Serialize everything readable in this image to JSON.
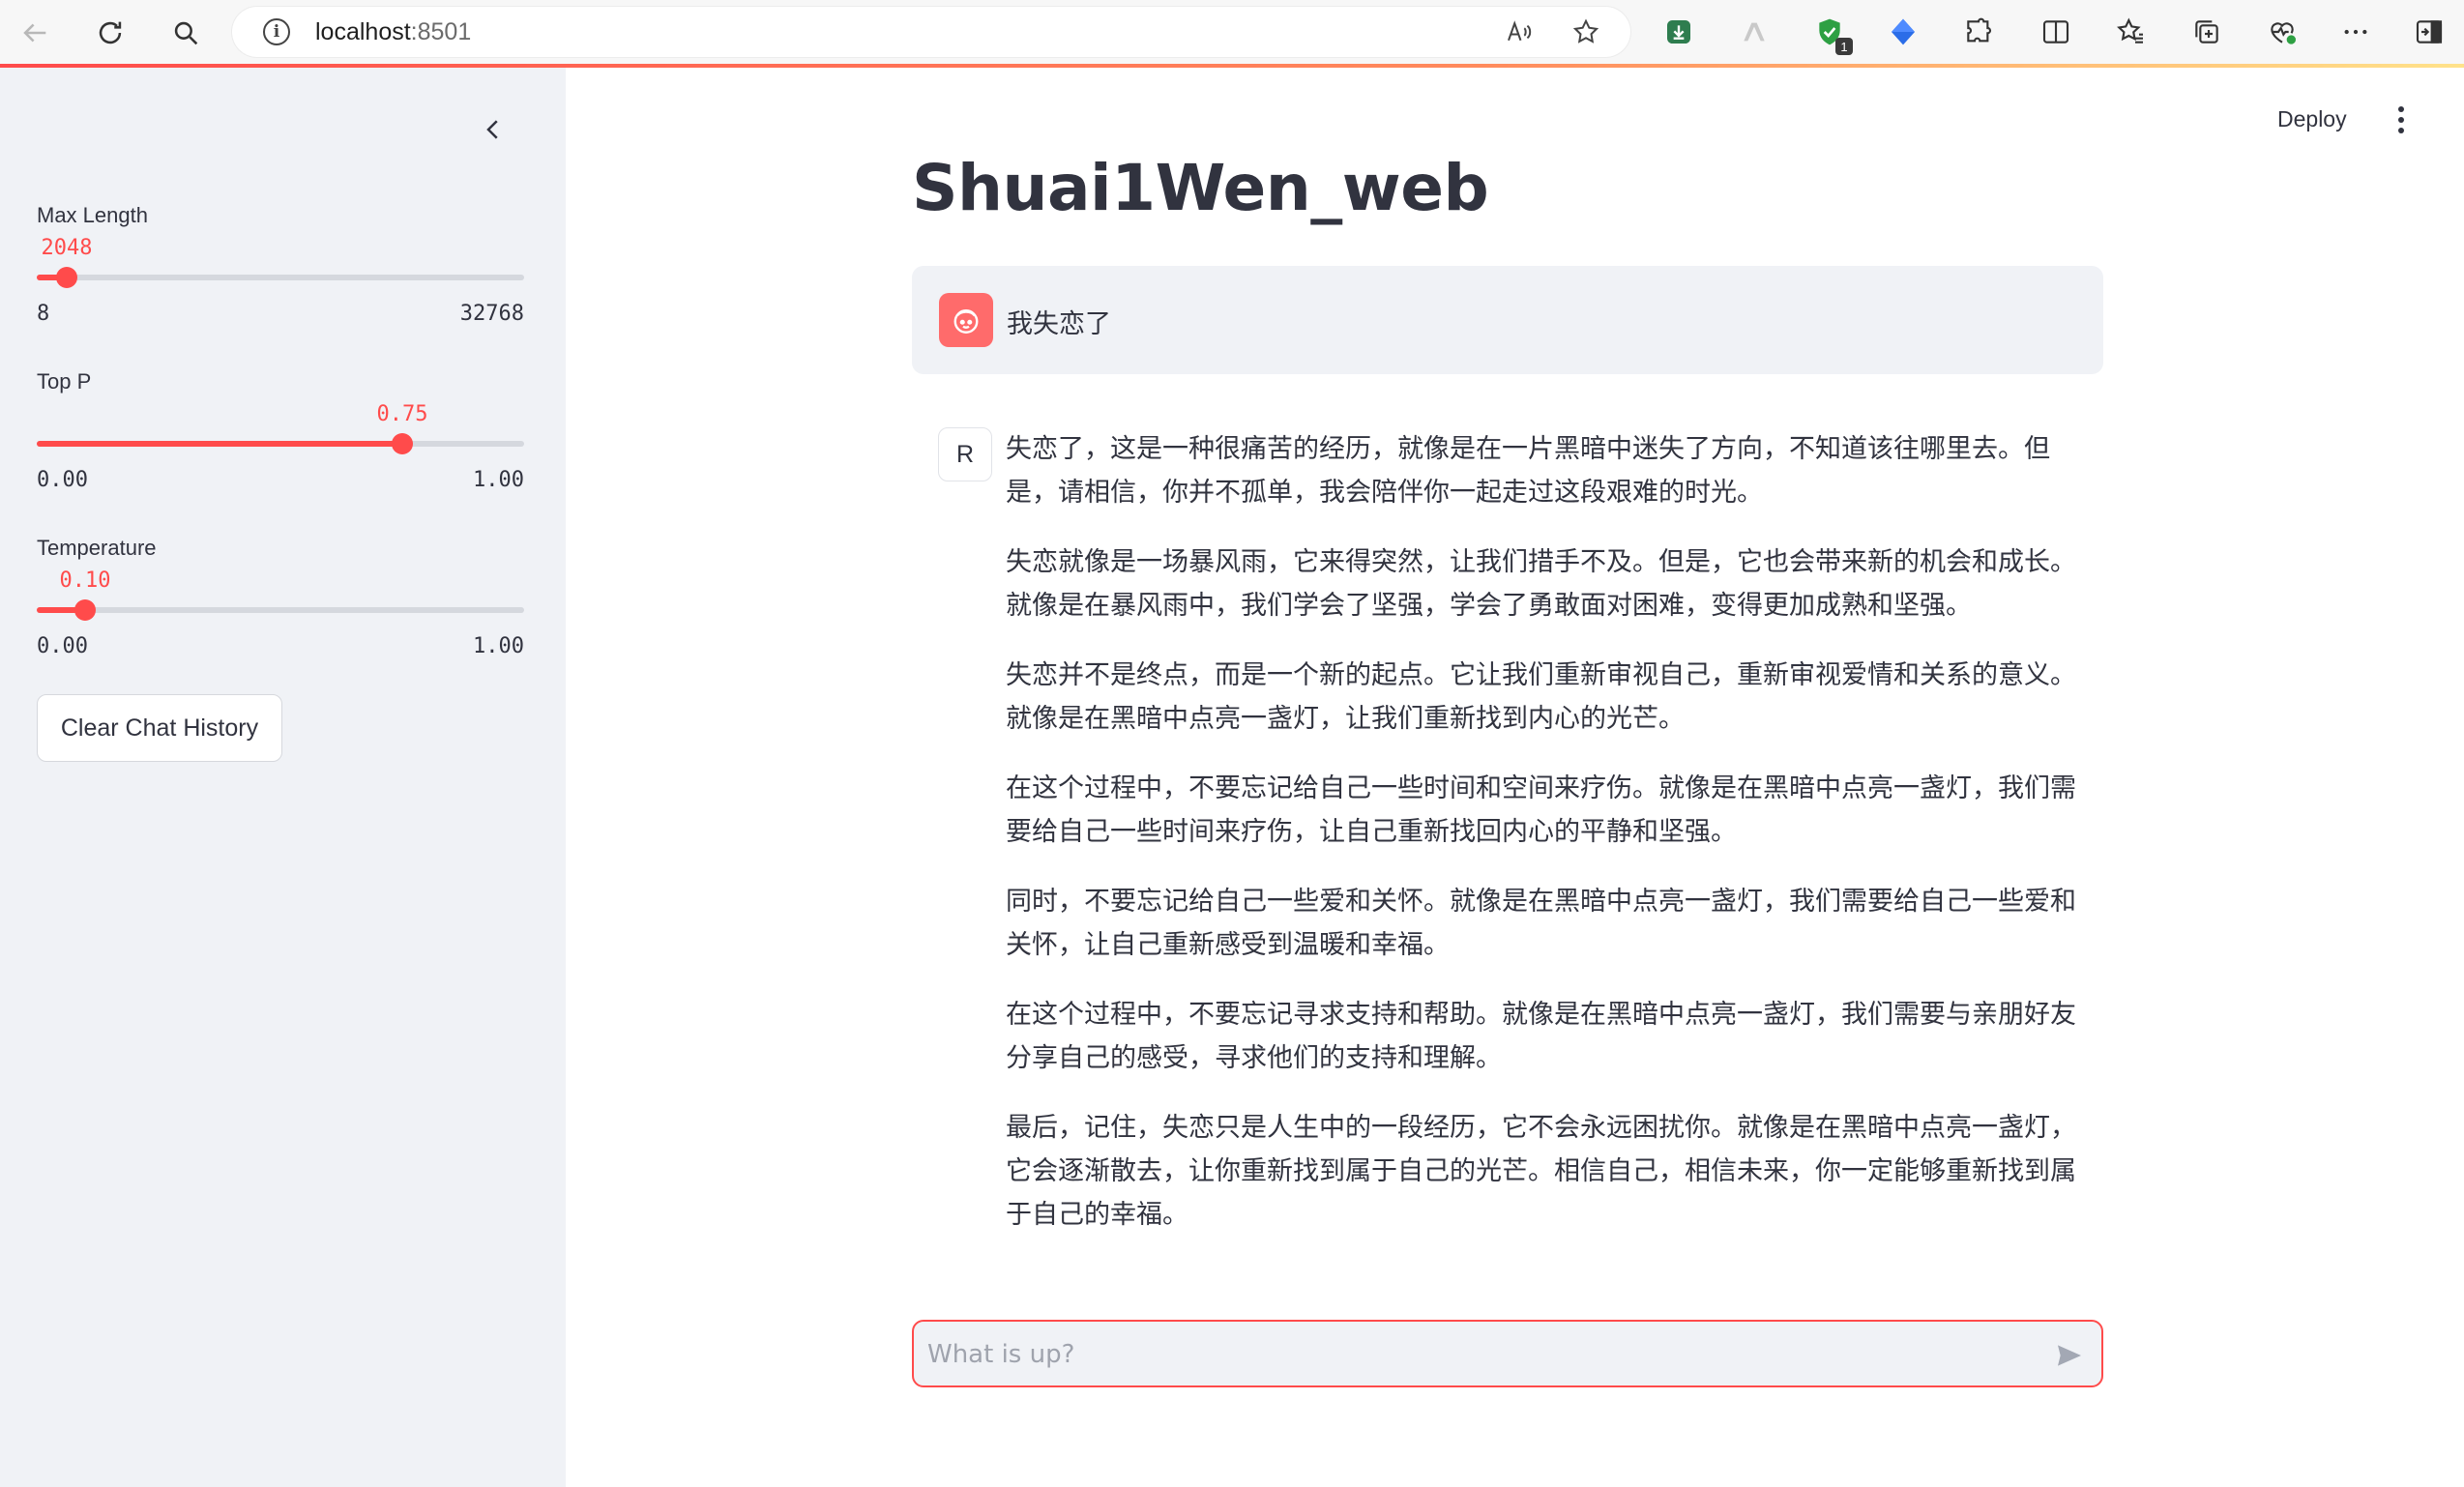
{
  "browser": {
    "url_host": "localhost",
    "url_port": ":8501",
    "extension_badge": "1",
    "icons": [
      "back-icon",
      "reload-icon",
      "search-icon",
      "site-info-icon",
      "read-aloud-icon",
      "favorite-star-icon",
      "download-extension-icon",
      "extension-icon",
      "shield-extension-icon",
      "diamond-extension-icon",
      "puzzle-icon",
      "split-screen-icon",
      "favorites-icon",
      "collections-icon",
      "heart-health-icon",
      "more-icon",
      "sidebar-toggle-icon"
    ]
  },
  "sidebar": {
    "sliders": [
      {
        "label": "Max Length",
        "value": "2048",
        "min": "8",
        "max": "32768",
        "fraction": 0.062
      },
      {
        "label": "Top P",
        "value": "0.75",
        "min": "0.00",
        "max": "1.00",
        "fraction": 0.75
      },
      {
        "label": "Temperature",
        "value": "0.10",
        "min": "0.00",
        "max": "1.00",
        "fraction": 0.1
      }
    ],
    "clear_button": "Clear Chat History"
  },
  "header": {
    "deploy": "Deploy"
  },
  "main": {
    "title": "Shuai1Wen_web",
    "user_message": "我失恋了",
    "bot_avatar": "R",
    "bot_paragraphs": [
      "失恋了，这是一种很痛苦的经历，就像是在一片黑暗中迷失了方向，不知道该往哪里去。但是，请相信，你并不孤单，我会陪伴你一起走过这段艰难的时光。",
      "失恋就像是一场暴风雨，它来得突然，让我们措手不及。但是，它也会带来新的机会和成长。就像是在暴风雨中，我们学会了坚强，学会了勇敢面对困难，变得更加成熟和坚强。",
      "失恋并不是终点，而是一个新的起点。它让我们重新审视自己，重新审视爱情和关系的意义。就像是在黑暗中点亮一盏灯，让我们重新找到内心的光芒。",
      "在这个过程中，不要忘记给自己一些时间和空间来疗伤。就像是在黑暗中点亮一盏灯，我们需要给自己一些时间来疗伤，让自己重新找回内心的平静和坚强。",
      "同时，不要忘记给自己一些爱和关怀。就像是在黑暗中点亮一盏灯，我们需要给自己一些爱和关怀，让自己重新感受到温暖和幸福。",
      "在这个过程中，不要忘记寻求支持和帮助。就像是在黑暗中点亮一盏灯，我们需要与亲朋好友分享自己的感受，寻求他们的支持和理解。",
      "最后，记住，失恋只是人生中的一段经历，它不会永远困扰你。就像是在黑暗中点亮一盏灯，它会逐渐散去，让你重新找到属于自己的光芒。相信自己，相信未来，你一定能够重新找到属于自己的幸福。"
    ],
    "input_placeholder": "What is up?"
  },
  "colors": {
    "accent": "#ff4b4b",
    "sidebar_bg": "#f0f2f6",
    "text": "#31333f"
  }
}
